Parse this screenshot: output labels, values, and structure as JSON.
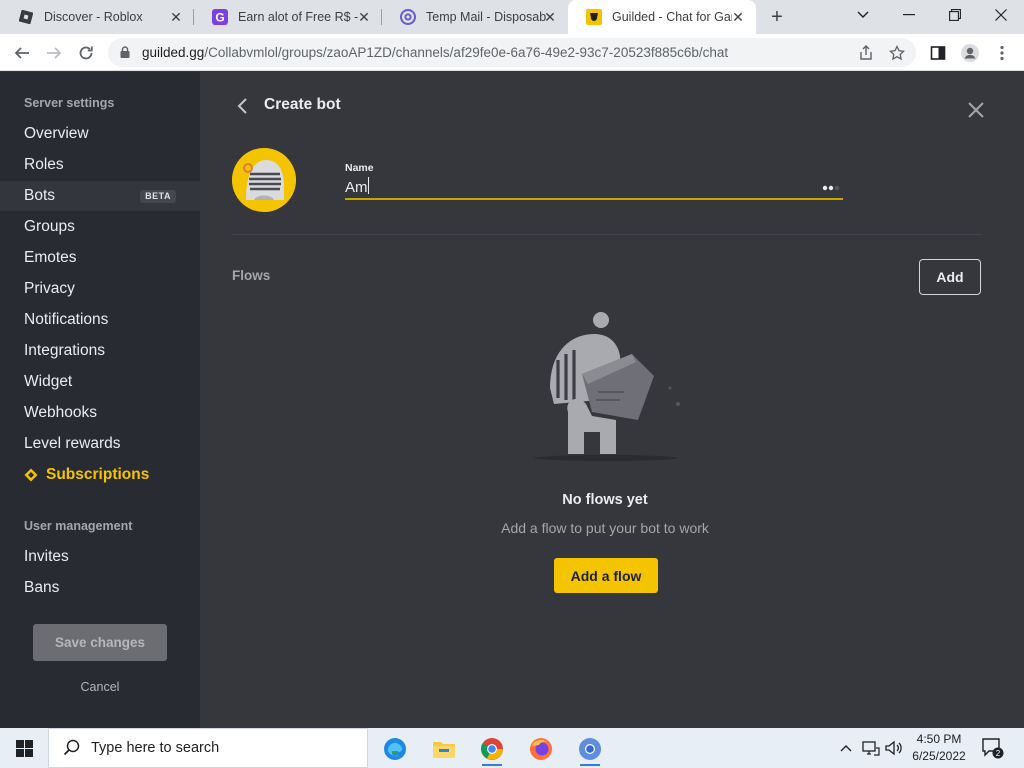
{
  "browser": {
    "tabs": [
      {
        "title": "Discover - Roblox",
        "active": false
      },
      {
        "title": "Earn alot of Free R$ - G",
        "active": false
      },
      {
        "title": "Temp Mail - Disposable",
        "active": false
      },
      {
        "title": "Guilded - Chat for Gam",
        "active": true
      }
    ],
    "url_host": "guilded.gg",
    "url_path": "/Collabvmlol/groups/zaoAP1ZD/channels/af29fe0e-6a76-49e2-93c7-20523f885c6b/chat"
  },
  "sidebar": {
    "server_section": "Server settings",
    "items": [
      {
        "label": "Overview"
      },
      {
        "label": "Roles"
      },
      {
        "label": "Bots",
        "badge": "BETA"
      },
      {
        "label": "Groups"
      },
      {
        "label": "Emotes"
      },
      {
        "label": "Privacy"
      },
      {
        "label": "Notifications"
      },
      {
        "label": "Integrations"
      },
      {
        "label": "Widget"
      },
      {
        "label": "Webhooks"
      },
      {
        "label": "Level rewards"
      },
      {
        "label": "Subscriptions"
      }
    ],
    "user_section": "User management",
    "user_items": [
      {
        "label": "Invites"
      },
      {
        "label": "Bans"
      }
    ],
    "save_label": "Save changes",
    "cancel_label": "Cancel"
  },
  "main": {
    "title": "Create bot",
    "name_label": "Name",
    "name_value": "Am",
    "flows_label": "Flows",
    "add_label": "Add",
    "empty_title": "No flows yet",
    "empty_subtitle": "Add a flow to put your bot to work",
    "add_flow_label": "Add a flow"
  },
  "taskbar": {
    "search_placeholder": "Type here to search",
    "time": "4:50 PM",
    "date": "6/25/2022",
    "notification_count": "2"
  },
  "colors": {
    "accent": "#f5c400",
    "sidebar_bg": "#292b32",
    "main_bg": "#36373d"
  }
}
